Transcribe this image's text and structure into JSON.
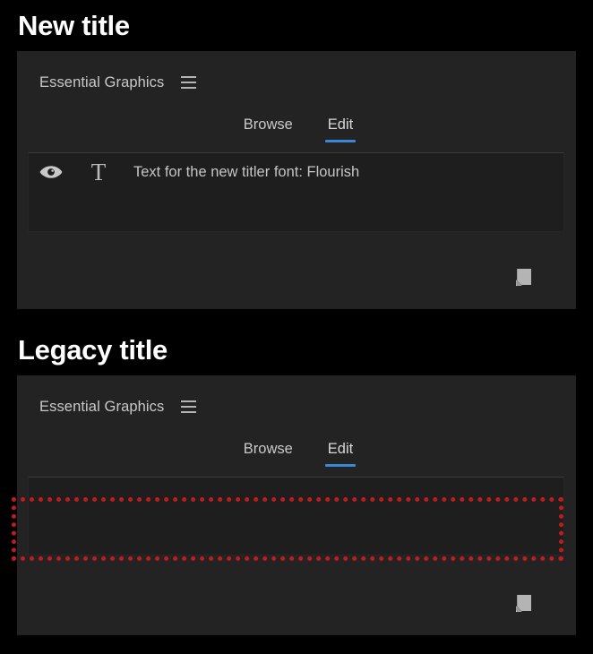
{
  "sections": [
    {
      "heading": "New title",
      "panel": {
        "title": "Essential Graphics",
        "menu_icon": "hamburger-icon",
        "tabs": [
          {
            "label": "Browse",
            "active": false
          },
          {
            "label": "Edit",
            "active": true
          }
        ],
        "active_tab_accent": "#3b87d8",
        "layers": [
          {
            "visibility_icon": "eye-icon",
            "type_icon": "text-type-icon",
            "type_icon_glyph": "T",
            "label": "Text for the new titler font: Flourish"
          }
        ],
        "footer_button": "new-layer-icon"
      },
      "highlight": null
    },
    {
      "heading": "Legacy title",
      "panel": {
        "title": "Essential Graphics",
        "menu_icon": "hamburger-icon",
        "tabs": [
          {
            "label": "Browse",
            "active": false
          },
          {
            "label": "Edit",
            "active": true
          }
        ],
        "active_tab_accent": "#3b87d8",
        "layers": [],
        "footer_button": "new-layer-icon"
      },
      "highlight": {
        "color": "#c21b1b",
        "style": "dotted",
        "note": "empty layer list region"
      }
    }
  ],
  "theme": {
    "background": "#000000",
    "panel_background": "#232323",
    "list_background": "#1e1e1e",
    "text_primary": "#c8c8c8",
    "heading_color": "#ffffff",
    "accent": "#3b87d8",
    "highlight": "#c21b1b"
  }
}
